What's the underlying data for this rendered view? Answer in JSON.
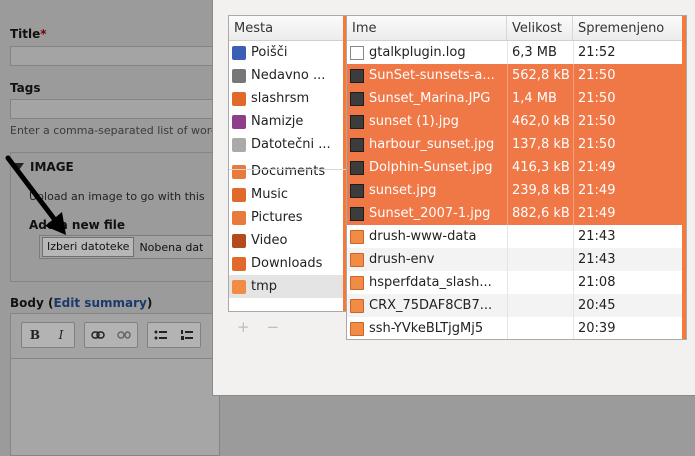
{
  "form": {
    "title_label": "Title",
    "title_required": "*",
    "tags_label": "Tags",
    "tags_description": "Enter a comma-separated list of word",
    "image_legend": "IMAGE",
    "image_description": "Upload an image to go with this",
    "add_file_label": "Add a new file",
    "choose_file_button": "Izberi datoteke",
    "no_file_text": "Nobena dat",
    "body_label": "Body",
    "body_paren_open": "(",
    "edit_summary_link": "Edit summary",
    "body_paren_close": ")",
    "toolbar": {
      "bold": "B",
      "italic": "I"
    }
  },
  "dialog": {
    "places_header": "Mesta",
    "places": [
      {
        "label": "Poišči",
        "icon": "search-icon",
        "color": "#3b5fb5"
      },
      {
        "label": "Nedavno ...",
        "icon": "recent-clock-icon",
        "color": "#777777"
      },
      {
        "label": "slashrsm",
        "icon": "home-folder-icon",
        "color": "#e0692b"
      },
      {
        "label": "Namizje",
        "icon": "desktop-icon",
        "color": "#8e3e8a"
      },
      {
        "label": "Datotečni ...",
        "icon": "filesystem-icon",
        "color": "#aaaaaa"
      },
      {
        "label": "Documents",
        "icon": "documents-folder-icon",
        "color": "#e87a3c"
      },
      {
        "label": "Music",
        "icon": "music-folder-icon",
        "color": "#e0692b"
      },
      {
        "label": "Pictures",
        "icon": "pictures-folder-icon",
        "color": "#e87a3c"
      },
      {
        "label": "Video",
        "icon": "video-folder-icon",
        "color": "#b44a1a"
      },
      {
        "label": "Downloads",
        "icon": "downloads-folder-icon",
        "color": "#e0692b"
      },
      {
        "label": "tmp",
        "icon": "folder-icon",
        "color": "#f28b43"
      }
    ],
    "add_symbol": "+",
    "remove_symbol": "−",
    "columns": {
      "name": "Ime",
      "size": "Velikost",
      "modified": "Spremenjeno"
    },
    "files": [
      {
        "name": "gtalkplugin.log",
        "size": "6,3 MB",
        "modified": "21:52",
        "type": "doc",
        "selected": false
      },
      {
        "name": "SunSet-sunsets-a...",
        "size": "562,8 kB",
        "modified": "21:50",
        "type": "img",
        "selected": true
      },
      {
        "name": "Sunset_Marina.JPG",
        "size": "1,4 MB",
        "modified": "21:50",
        "type": "img",
        "selected": true
      },
      {
        "name": "sunset (1).jpg",
        "size": "462,0 kB",
        "modified": "21:50",
        "type": "img",
        "selected": true
      },
      {
        "name": "harbour_sunset.jpg",
        "size": "137,8 kB",
        "modified": "21:50",
        "type": "img",
        "selected": true
      },
      {
        "name": "Dolphin-Sunset.jpg",
        "size": "416,3 kB",
        "modified": "21:49",
        "type": "img",
        "selected": true
      },
      {
        "name": "sunset.jpg",
        "size": "239,8 kB",
        "modified": "21:49",
        "type": "img",
        "selected": true
      },
      {
        "name": "Sunset_2007-1.jpg",
        "size": "882,6 kB",
        "modified": "21:49",
        "type": "img",
        "selected": true
      },
      {
        "name": "drush-www-data",
        "size": "",
        "modified": "21:43",
        "type": "folder",
        "selected": false
      },
      {
        "name": "drush-env",
        "size": "",
        "modified": "21:43",
        "type": "folder",
        "selected": false
      },
      {
        "name": "hsperfdata_slash...",
        "size": "",
        "modified": "21:08",
        "type": "folder",
        "selected": false
      },
      {
        "name": "CRX_75DAF8CB7...",
        "size": "",
        "modified": "20:45",
        "type": "folder",
        "selected": false
      },
      {
        "name": "ssh-YVkeBLTjgMj5",
        "size": "",
        "modified": "20:39",
        "type": "folder",
        "selected": false
      }
    ],
    "accent_color": "#f07746"
  }
}
